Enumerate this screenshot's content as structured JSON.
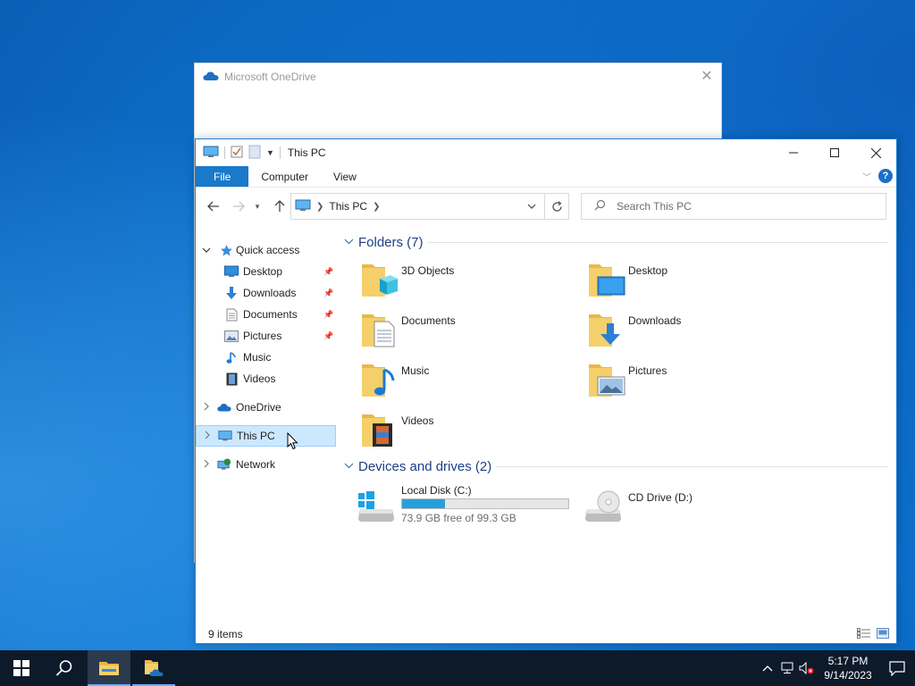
{
  "onedrive": {
    "title": "Microsoft OneDrive"
  },
  "window": {
    "title": "This PC"
  },
  "ribbon": {
    "tabs": [
      "File",
      "Computer",
      "View"
    ]
  },
  "address": {
    "crumb": "This PC"
  },
  "search": {
    "placeholder": "Search This PC"
  },
  "nav": {
    "quick_access": "Quick access",
    "quick_items": [
      "Desktop",
      "Downloads",
      "Documents",
      "Pictures",
      "Music",
      "Videos"
    ],
    "onedrive": "OneDrive",
    "this_pc": "This PC",
    "network": "Network"
  },
  "groups": {
    "folders": "Folders (7)",
    "drives": "Devices and drives (2)"
  },
  "folders": [
    "3D Objects",
    "Desktop",
    "Documents",
    "Downloads",
    "Music",
    "Pictures",
    "Videos"
  ],
  "drives": {
    "c": {
      "name": "Local Disk (C:)",
      "free": "73.9 GB free of 99.3 GB",
      "used_fraction": 0.256
    },
    "d": {
      "name": "CD Drive (D:)"
    }
  },
  "status": {
    "count": "9 items"
  },
  "clock": {
    "time": "5:17 PM",
    "date": "9/14/2023"
  },
  "colors": {
    "accent": "#1979ca",
    "selection": "#cce8ff",
    "drive_fill": "#26a0da",
    "taskbar": "#0d1a2a"
  }
}
